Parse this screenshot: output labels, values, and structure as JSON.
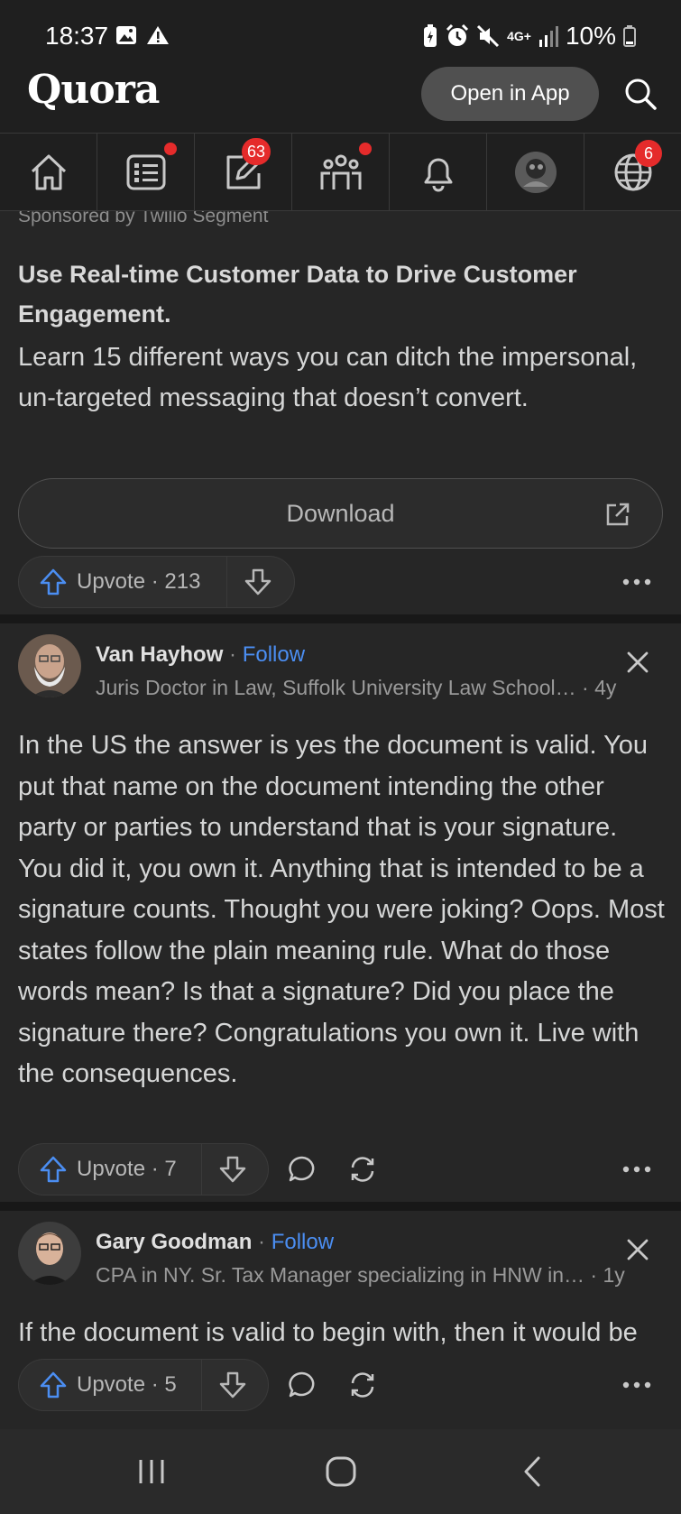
{
  "status_bar": {
    "time": "18:37",
    "network": "4G+",
    "battery": "10%",
    "icons": [
      "image-icon",
      "warning-icon",
      "battery-saver-icon",
      "alarm-icon",
      "mute-icon",
      "signal-icon",
      "battery-icon"
    ]
  },
  "header": {
    "logo": "Quora",
    "open_app_label": "Open in App",
    "search_icon": "search-icon"
  },
  "nav": {
    "items": [
      {
        "name": "home-icon",
        "badge": ""
      },
      {
        "name": "following-icon",
        "badge": "dot"
      },
      {
        "name": "answer-icon",
        "badge": "63"
      },
      {
        "name": "spaces-icon",
        "badge": "dot"
      },
      {
        "name": "notifications-icon",
        "badge": ""
      },
      {
        "name": "profile-avatar",
        "badge": ""
      },
      {
        "name": "languages-icon",
        "badge": "6"
      }
    ]
  },
  "ad": {
    "sponsored": "Sponsored by Twilio Segment",
    "title": "Use Real-time Customer Data to Drive Customer Engagement.",
    "body": "Learn 15 different ways you can ditch the impersonal, un-targeted messaging that doesn’t convert.",
    "download_label": "Download",
    "upvote_label": "Upvote · 213"
  },
  "posts": [
    {
      "author": "Van Hayhow",
      "follow": "Follow",
      "separator": "·",
      "credential": "Juris Doctor in Law, Suffolk University Law School…",
      "age": "· 4y",
      "body": "In the US the answer is yes the document is valid. You put that name on the document intending the other party or parties to understand that is your signature. You did it, you own it. Anything that is intended to be a signature counts. Thought you were joking? Oops. Most states follow the plain meaning rule. What do those words mean? Is that a signature? Did you place the signature there? Congratulations you own it. Live with the consequences.",
      "upvote_label": "Upvote · 7"
    },
    {
      "author": "Gary Goodman",
      "follow": "Follow",
      "separator": "·",
      "credential": "CPA in NY. Sr. Tax Manager specializing in HNW in…",
      "age": "· 1y",
      "body": "If the document is valid to begin with, then it would be an uphill battle for you to get it thrown out",
      "upvote_label": "Upvote · 5"
    }
  ],
  "colors": {
    "background": "#262626",
    "bar": "#1f1f1f",
    "accent_blue": "#4b8ef2",
    "badge_red": "#e52b2b"
  }
}
